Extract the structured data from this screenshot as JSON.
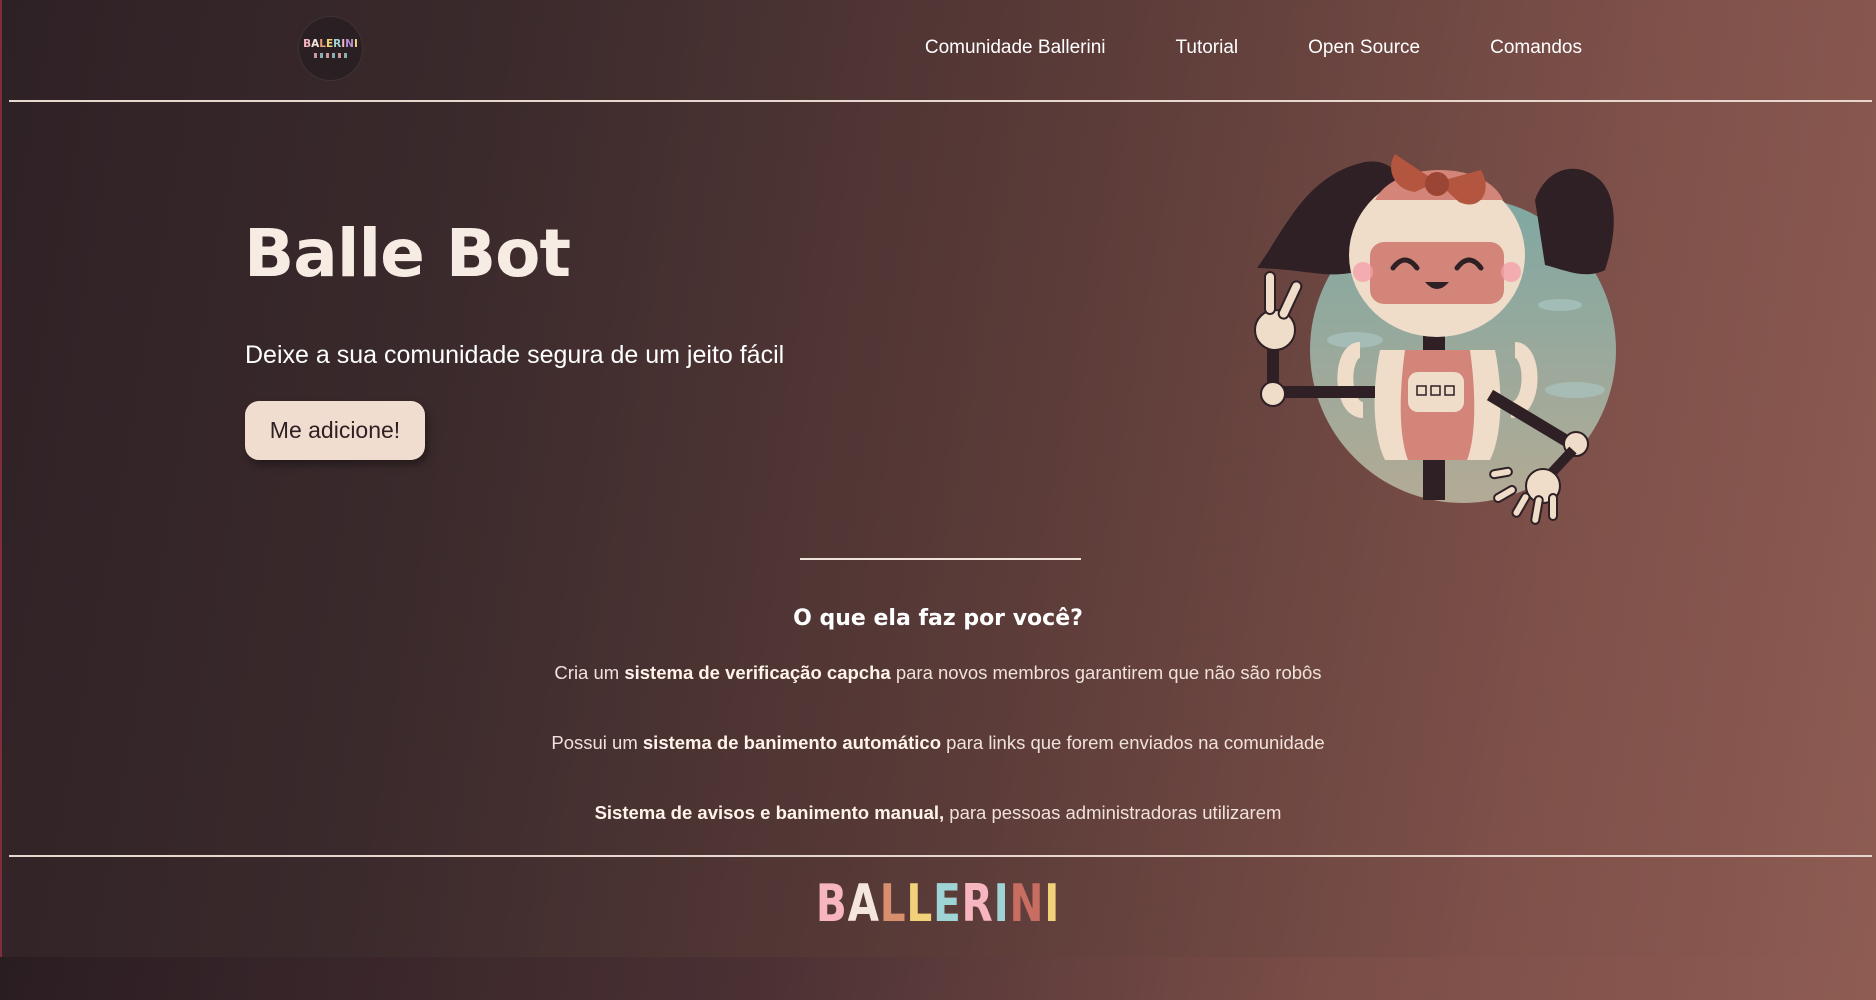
{
  "header": {
    "logo_text": "BALLERINI",
    "nav": [
      {
        "label": "Comunidade Ballerini"
      },
      {
        "label": "Tutorial"
      },
      {
        "label": "Open Source"
      },
      {
        "label": "Comandos"
      }
    ]
  },
  "hero": {
    "title": "Balle Bot",
    "subtitle": "Deixe a sua comunidade segura de um jeito fácil",
    "cta_label": "Me adicione!"
  },
  "features": {
    "title": "O que ela faz por você?",
    "items": [
      {
        "pre": "Cria um ",
        "bold": "sistema de verificação capcha",
        "post": " para novos membros garantirem que não são robôs"
      },
      {
        "pre": "Possui um ",
        "bold": "sistema de banimento automático",
        "post": " para links que forem enviados na comunidade"
      },
      {
        "pre": "",
        "bold": "Sistema de avisos e banimento manual,",
        "post": " para pessoas administradoras utilizarem"
      }
    ]
  },
  "footer": {
    "brand_letters": [
      "B",
      "A",
      "L",
      "L",
      "E",
      "R",
      "I",
      "N",
      "I"
    ]
  },
  "colors": {
    "accent_button": "#f1ddcf",
    "text_light": "#f4e6dc",
    "robot_pink": "#d4857a",
    "robot_cream": "#efdcc9",
    "hair_dark": "#2e2024",
    "bow": "#b4563f",
    "sky": "#8fb2aa"
  },
  "icons": [
    "ballerini-logo",
    "robot-illustration"
  ]
}
